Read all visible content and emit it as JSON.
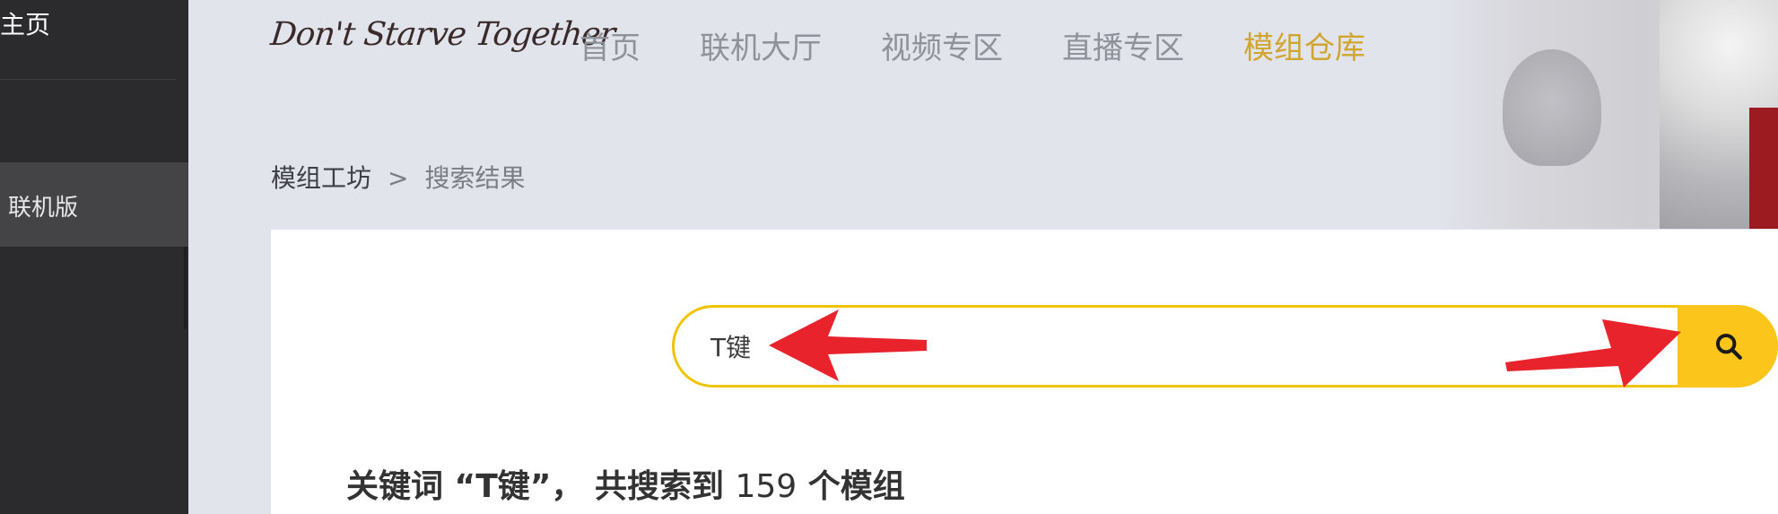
{
  "sidebar": {
    "title": "主页",
    "selected_item": "联机版"
  },
  "header": {
    "logo_text": "Don't Starve Together",
    "nav": [
      {
        "label": "首页",
        "active": false
      },
      {
        "label": "联机大厅",
        "active": false
      },
      {
        "label": "视频专区",
        "active": false
      },
      {
        "label": "直播专区",
        "active": false
      },
      {
        "label": "模组仓库",
        "active": true
      }
    ],
    "accent_color": "#d0a530"
  },
  "breadcrumb": {
    "root": "模组工坊",
    "separator": ">",
    "current": "搜索结果"
  },
  "search": {
    "value": "T键",
    "button_color": "#fbc51b",
    "border_color": "#f0c400",
    "icon": "search-icon"
  },
  "annotation_color": "#e8232b",
  "results": {
    "prefix": "关键词 “",
    "keyword": "T键",
    "middle": "”， 共搜索到 ",
    "count": "159",
    "suffix": " 个模组"
  }
}
